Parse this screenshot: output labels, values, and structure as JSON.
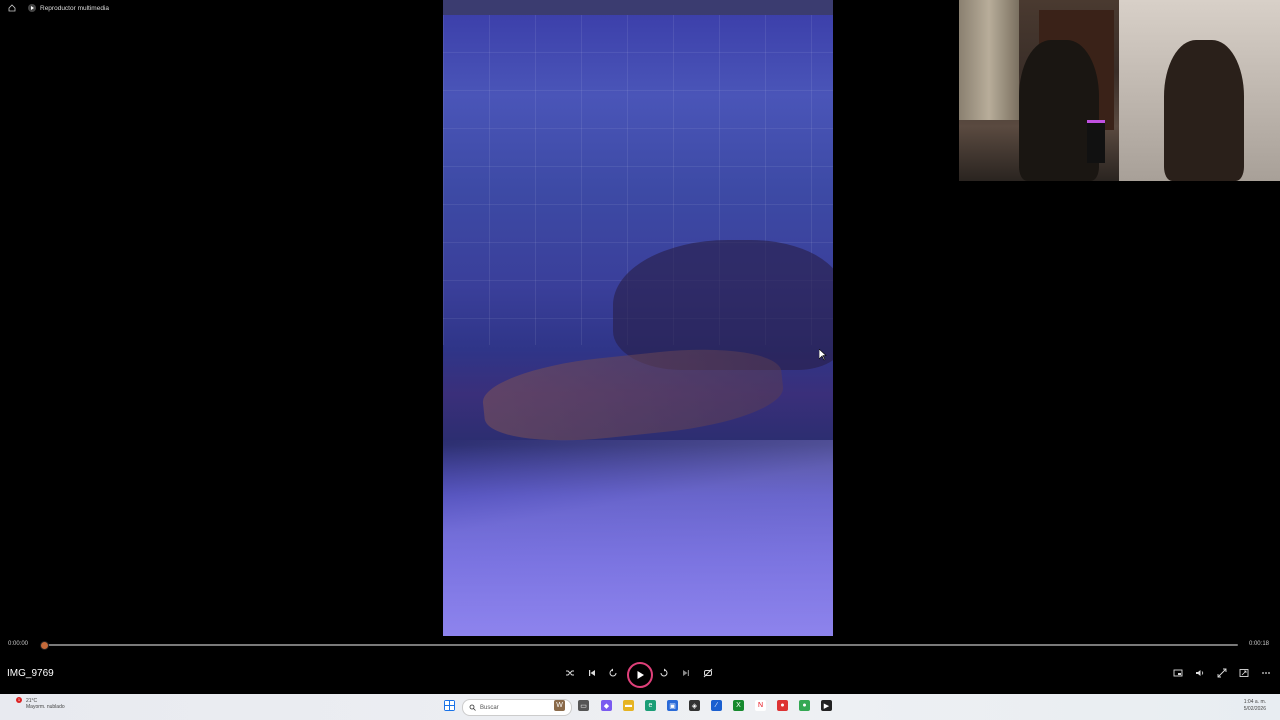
{
  "window": {
    "title": "Reproductor multimedia"
  },
  "player": {
    "file_name": "IMG_9769",
    "time_current": "0:00:00",
    "time_total": "0:00:18",
    "progress_fraction": 0.0,
    "accent_color": "#e0407a"
  },
  "controls": {
    "center": [
      "shuffle-icon",
      "previous-icon",
      "rewind-10-icon",
      "play-icon",
      "forward-30-icon",
      "next-icon",
      "repeat-off-icon"
    ],
    "right": [
      "miniplayer-icon",
      "volume-icon",
      "fullscreen-icon",
      "pip-icon",
      "more-options-icon"
    ]
  },
  "taskbar": {
    "weather_temp": "21°C",
    "weather_desc": "Mayorm. nublado",
    "weather_badge": "1",
    "search_placeholder": "Buscar",
    "time": "1:04 a. m.",
    "date": "5/02/2026",
    "apps": [
      "windows-start-icon",
      "search-icon",
      "widgets-icon",
      "task-view-icon",
      "copilot-icon",
      "file-explorer-icon",
      "edge-icon",
      "store-icon",
      "store-alt-icon",
      "visual-studio-icon",
      "xbox-icon",
      "netflix-icon",
      "chrome-icon",
      "chrome-alt-icon",
      "media-player-icon"
    ]
  }
}
